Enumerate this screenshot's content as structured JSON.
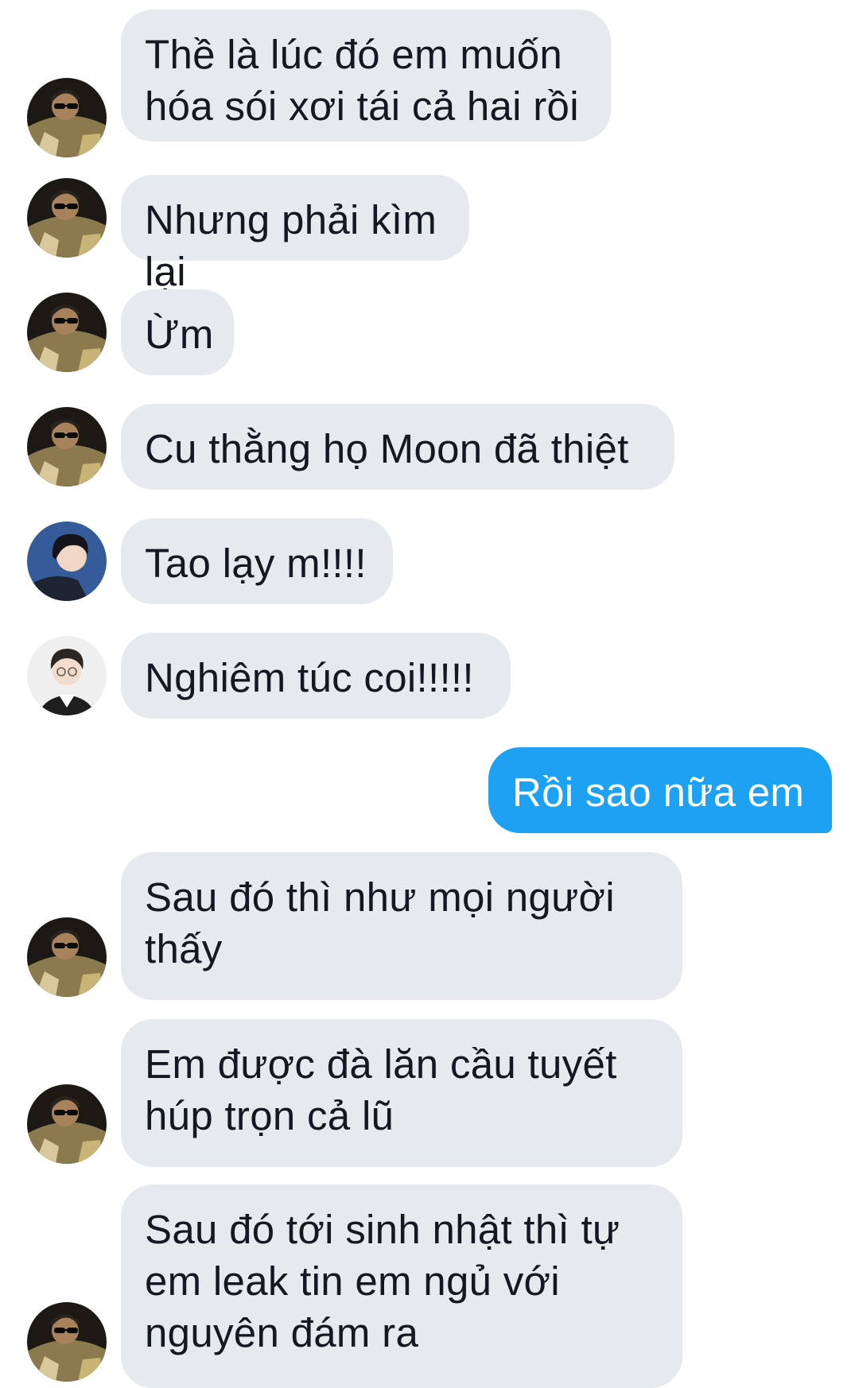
{
  "conversation": {
    "messages": [
      {
        "side": "in",
        "avatar": "avatar-dark-sunglasses",
        "text": "Thề là lúc đó em muốn\nhóa sói xơi tái cả hai rồi"
      },
      {
        "side": "in",
        "avatar": "avatar-dark-sunglasses",
        "text": "Nhưng phải kìm lại"
      },
      {
        "side": "in",
        "avatar": "avatar-dark-sunglasses",
        "text": "Ừm"
      },
      {
        "side": "in",
        "avatar": "avatar-dark-sunglasses",
        "text": "Cu thằng họ Moon đã thiệt"
      },
      {
        "side": "in",
        "avatar": "avatar-blue-background",
        "text": "Tao lạy m!!!!"
      },
      {
        "side": "in",
        "avatar": "avatar-glasses-light",
        "text": "Nghiêm túc coi!!!!!"
      },
      {
        "side": "out",
        "text": "Rồi sao nữa em"
      },
      {
        "side": "in",
        "avatar": "avatar-dark-sunglasses",
        "text": "Sau đó thì như mọi người\nthấy"
      },
      {
        "side": "in",
        "avatar": "avatar-dark-sunglasses",
        "text": "Em được đà lăn cầu tuyết\nhúp trọn cả lũ"
      },
      {
        "side": "in",
        "avatar": "avatar-dark-sunglasses",
        "text": "Sau đó tới sinh nhật thì tự\nem leak tin em ngủ với\nnguyên đám ra"
      }
    ]
  },
  "colors": {
    "incoming_bubble": "#e6eaef",
    "outgoing_bubble": "#1da1f2",
    "incoming_text": "#141823",
    "outgoing_text": "#ffffff"
  }
}
